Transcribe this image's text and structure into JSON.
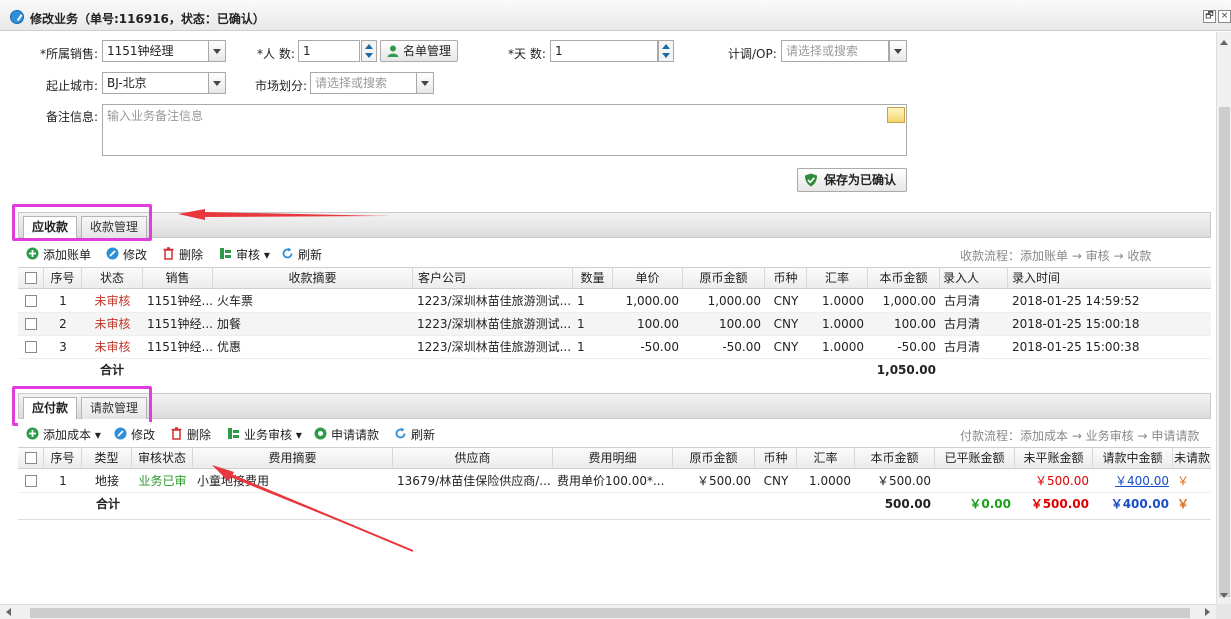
{
  "window": {
    "title": "修改业务（单号:116916，状态：已确认）",
    "restore_glyph": "🗗",
    "close_glyph": "×"
  },
  "form": {
    "sales_label": "*所属销售:",
    "sales_value": "1151钟经理",
    "people_label": "*人 数:",
    "people_value": "1",
    "namelist_button": "名单管理",
    "days_label": "*天 数:",
    "days_value": "1",
    "op_label": "计调/OP:",
    "op_placeholder": "请选择或搜索",
    "city_label": "起止城市:",
    "city_value": "BJ-北京",
    "market_label": "市场划分:",
    "market_placeholder": "请选择或搜索",
    "remark_label": "备注信息:",
    "remark_placeholder": "输入业务备注信息",
    "confirm_button": "保存为已确认"
  },
  "receivable": {
    "tabs": [
      "应收款",
      "收款管理"
    ],
    "toolbar": {
      "add": "添加账单",
      "edit": "修改",
      "delete": "删除",
      "audit": "审核",
      "refresh": "刷新",
      "flow": "收款流程：添加账单 → 审核 → 收款"
    },
    "columns": [
      "序号",
      "状态",
      "销售",
      "收款摘要",
      "客户公司",
      "数量",
      "单价",
      "原币金额",
      "币种",
      "汇率",
      "本币金额",
      "录入人",
      "录入时间"
    ],
    "rows": [
      {
        "no": "1",
        "status": "未审核",
        "sales": "1151钟经...",
        "summary": "火车票",
        "company": "1223/深圳林苗佳旅游测试...",
        "qty": "1",
        "price": "1,000.00",
        "orig": "1,000.00",
        "currency": "CNY",
        "rate": "1.0000",
        "local": "1,000.00",
        "entered_by": "古月清",
        "time": "2018-01-25 14:59:52"
      },
      {
        "no": "2",
        "status": "未审核",
        "sales": "1151钟经...",
        "summary": "加餐",
        "company": "1223/深圳林苗佳旅游测试...",
        "qty": "1",
        "price": "100.00",
        "orig": "100.00",
        "currency": "CNY",
        "rate": "1.0000",
        "local": "100.00",
        "entered_by": "古月清",
        "time": "2018-01-25 15:00:18"
      },
      {
        "no": "3",
        "status": "未审核",
        "sales": "1151钟经...",
        "summary": "优惠",
        "company": "1223/深圳林苗佳旅游测试...",
        "qty": "1",
        "price": "-50.00",
        "orig": "-50.00",
        "currency": "CNY",
        "rate": "1.0000",
        "local": "-50.00",
        "entered_by": "古月清",
        "time": "2018-01-25 15:00:38"
      }
    ],
    "total_label": "合计",
    "total_local": "1,050.00"
  },
  "payable": {
    "tabs": [
      "应付款",
      "请款管理"
    ],
    "toolbar": {
      "add": "添加成本",
      "edit": "修改",
      "delete": "删除",
      "audit": "业务审核",
      "request": "申请请款",
      "refresh": "刷新",
      "flow": "付款流程：添加成本 → 业务审核 → 申请请款"
    },
    "columns": [
      "序号",
      "类型",
      "审核状态",
      "费用摘要",
      "供应商",
      "费用明细",
      "原币金额",
      "币种",
      "汇率",
      "本币金额",
      "已平账金额",
      "未平账金额",
      "请款中金额",
      "未请款"
    ],
    "rows": [
      {
        "no": "1",
        "type": "地接",
        "status": "业务已审",
        "summary": "小童地接费用",
        "supplier": "13679/林苗佳保险供应商/...",
        "detail": "费用单价100.00*...",
        "orig": "￥500.00",
        "currency": "CNY",
        "rate": "1.0000",
        "local": "￥500.00",
        "settled": "",
        "unsettled": "￥500.00",
        "requesting": "￥400.00",
        "unrequested": "￥"
      }
    ],
    "total_label": "合计",
    "total_local": "500.00",
    "total_settled": "￥0.00",
    "total_unsettled": "￥500.00",
    "total_requesting": "￥400.00",
    "total_unrequested": "￥"
  },
  "colors": {
    "highlight": "#e23cde",
    "arrow": "#e8383d"
  }
}
